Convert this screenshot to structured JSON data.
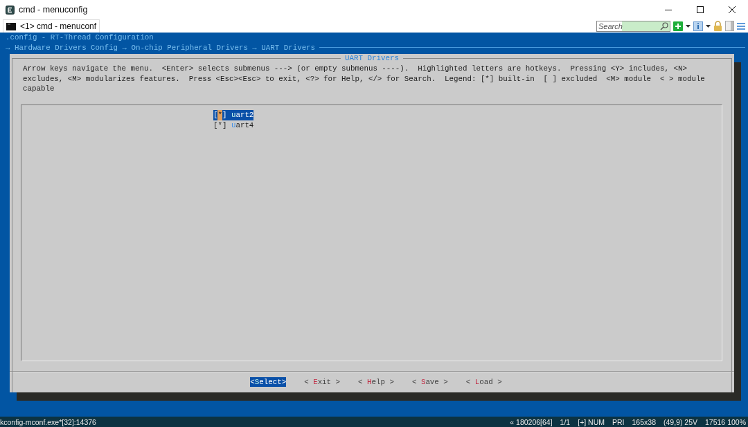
{
  "window": {
    "title": "cmd - menuconfig"
  },
  "tabs": [
    {
      "label": "<1> cmd - menuconf",
      "selected": true
    }
  ],
  "toolbar": {
    "search": {
      "placeholder": "Search"
    }
  },
  "terminal": {
    "header": [
      ".config - RT-Thread Configuration",
      "→ Hardware Drivers Config → On-chip Peripheral Drivers → UART Drivers"
    ],
    "dialog": {
      "title": "UART Drivers",
      "help": "Arrow keys navigate the menu.  <Enter> selects submenus ---> (or empty submenus ----).  Highlighted letters are hotkeys.  Pressing <Y> includes, <N> excludes, <M> modularizes features.  Press <Esc><Esc> to exit, <?> for Help, </> for Search.  Legend: [*] built-in  [ ] excluded  <M> module  < > module capable",
      "items": [
        {
          "box_open": "[",
          "mark": "*",
          "box_close": "]",
          "label": "uart2",
          "selected": true
        },
        {
          "box_open": "[",
          "mark": "*",
          "box_close": "]",
          "label": "uart4",
          "selected": false
        }
      ],
      "buttons": [
        {
          "open": "<",
          "label": "Select",
          "close": ">",
          "selected": true
        },
        {
          "open": "< ",
          "label": "Exit",
          "close": " >",
          "selected": false
        },
        {
          "open": "< ",
          "label": "Help",
          "close": " >",
          "selected": false
        },
        {
          "open": "< ",
          "label": "Save",
          "close": " >",
          "selected": false
        },
        {
          "open": "< ",
          "label": "Load",
          "close": " >",
          "selected": false
        }
      ]
    }
  },
  "status_bar": {
    "process": "kconfig-mconf.exe*[32]:14376",
    "fields": [
      "« 180206[64]",
      "1/1",
      "[+] NUM",
      "PRI",
      "165x38",
      "(49,9) 25V",
      "17516 100%"
    ]
  }
}
